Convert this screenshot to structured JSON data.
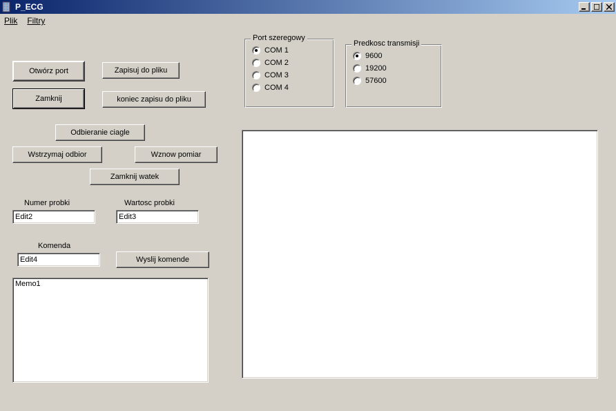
{
  "window": {
    "title": "P_ECG"
  },
  "menu": {
    "plik": "Plik",
    "filtry": "Filtry"
  },
  "buttons": {
    "open_port": "Otwórz port",
    "close": "Zamknij",
    "save_to_file": "Zapisuj do pliku",
    "end_save": "koniec zapisu do pliku",
    "continuous_receive": "Odbieranie ciagle",
    "pause_receive": "Wstrzymaj odbior",
    "resume_measure": "Wznow pomiar",
    "close_thread": "Zamknij watek",
    "send_command": "Wyslij komende"
  },
  "groups": {
    "serial_port": {
      "title": "Port szeregowy",
      "options": [
        "COM 1",
        "COM 2",
        "COM 3",
        "COM 4"
      ],
      "selected": 0
    },
    "baud": {
      "title": "Predkosc transmisji",
      "options": [
        "9600",
        "19200",
        "57600"
      ],
      "selected": 0
    }
  },
  "labels": {
    "sample_number": "Numer probki",
    "sample_value": "Wartosc probki",
    "command": "Komenda"
  },
  "edits": {
    "sample_number": "Edit2",
    "sample_value": "Edit3",
    "command": "Edit4"
  },
  "memo": "Memo1"
}
